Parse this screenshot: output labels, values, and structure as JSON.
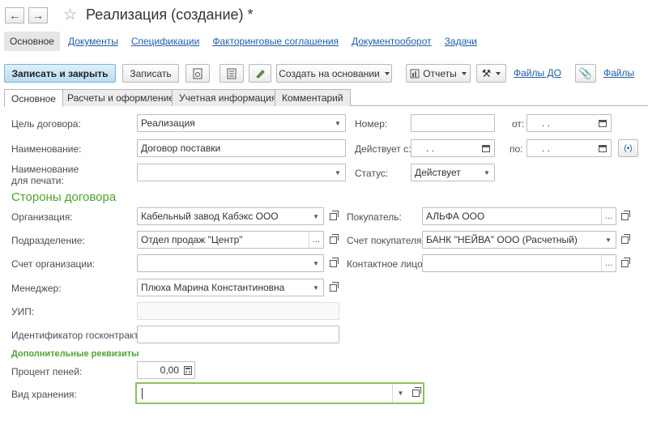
{
  "window": {
    "title": "Реализация (создание) *"
  },
  "topnav": [
    "Основное",
    "Документы",
    "Спецификации",
    "Факторинговые соглашения",
    "Документооборот",
    "Задачи"
  ],
  "toolbar": {
    "save_close": "Записать и закрыть",
    "save": "Записать",
    "create_based": "Создать на основании",
    "reports": "Отчеты",
    "files_do": "Файлы ДО",
    "files": "Файлы"
  },
  "tabs": [
    "Основное",
    "Расчеты и оформление",
    "Учетная информация",
    "Комментарий"
  ],
  "form": {
    "goal_label": "Цель договора:",
    "goal_value": "Реализация",
    "number_label": "Номер:",
    "number_value": "",
    "from_label": "от:",
    "from_value": ". .",
    "name_label": "Наименование:",
    "name_value": "Договор поставки",
    "valid_from_label": "Действует с:",
    "valid_from_value": ". .",
    "to_label": "по:",
    "to_value": ". .",
    "print_name_label_1": "Наименование",
    "print_name_label_2": "для печати:",
    "print_name_value": "",
    "status_label": "Статус:",
    "status_value": "Действует",
    "parties_title": "Стороны договора",
    "org_label": "Организация:",
    "org_value": "Кабельный завод Кабэкс ООО",
    "buyer_label": "Покупатель:",
    "buyer_value": "АЛЬФА ООО",
    "dept_label": "Подразделение:",
    "dept_value": "Отдел продаж \"Центр\"",
    "buyer_acc_label": "Счет покупателя:",
    "buyer_acc_value": "БАНК \"НЕЙВА\" ООО (Расчетный)",
    "org_acc_label": "Счет организации:",
    "org_acc_value": "",
    "contact_label": "Контактное лицо:",
    "contact_value": "",
    "manager_label": "Менеджер:",
    "manager_value": "Плюха Марина Константиновна",
    "uip_label": "УИП:",
    "uip_value": "",
    "gov_label": "Идентификатор госконтракта:",
    "gov_value": "",
    "extra_title": "Дополнительные реквизиты",
    "penalty_label": "Процент пеней:",
    "penalty_value": "0,00",
    "storage_label": "Вид хранения:",
    "storage_value": ""
  }
}
